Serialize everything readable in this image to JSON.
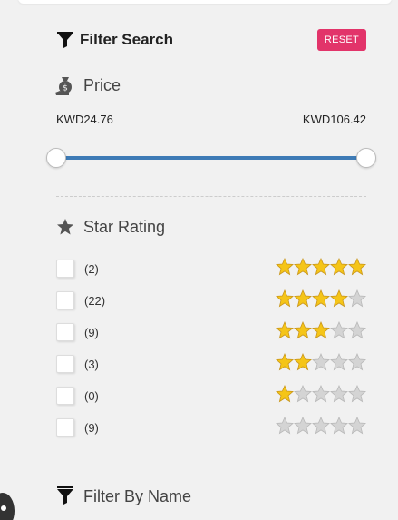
{
  "filter": {
    "title": "Filter Search",
    "reset_label": "RESET"
  },
  "price": {
    "title": "Price",
    "min": "KWD24.76",
    "max": "KWD106.42",
    "range_fraction": [
      0,
      1
    ]
  },
  "star_rating": {
    "title": "Star Rating",
    "rows": [
      {
        "count": "(2)",
        "stars": 5
      },
      {
        "count": "(22)",
        "stars": 4
      },
      {
        "count": "(9)",
        "stars": 3
      },
      {
        "count": "(3)",
        "stars": 2
      },
      {
        "count": "(0)",
        "stars": 1
      },
      {
        "count": "(9)",
        "stars": 0
      }
    ]
  },
  "filter_by_name": {
    "title": "Filter By Name"
  },
  "colors": {
    "accent": "#e2346a",
    "slider": "#3e7bb6",
    "star_filled": "#f5c518",
    "star_empty": "#d4d4d4"
  }
}
